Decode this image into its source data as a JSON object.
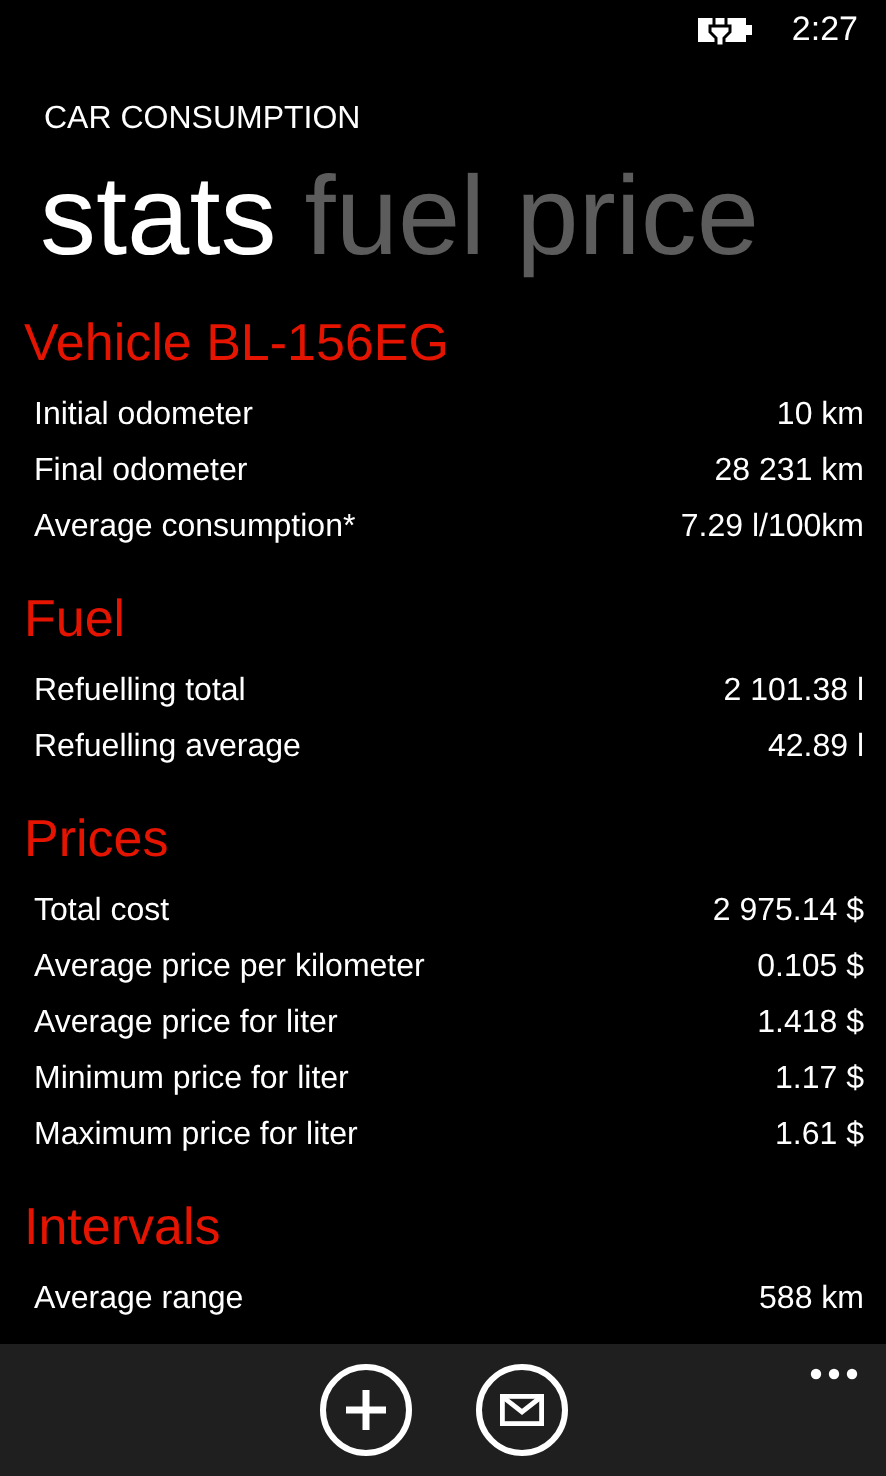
{
  "status_bar": {
    "time": "2:27",
    "charging": true
  },
  "app_title": "CAR CONSUMPTION",
  "pivot": [
    {
      "label": "stats",
      "selected": true
    },
    {
      "label": "fuel price",
      "selected": false
    }
  ],
  "sections": [
    {
      "title": "Vehicle BL-156EG",
      "rows": [
        {
          "label": "Initial odometer",
          "value": "10 km"
        },
        {
          "label": "Final odometer",
          "value": "28 231 km"
        },
        {
          "label": "Average consumption*",
          "value": "7.29 l/100km"
        }
      ]
    },
    {
      "title": "Fuel",
      "rows": [
        {
          "label": "Refuelling total",
          "value": "2 101.38 l"
        },
        {
          "label": "Refuelling average",
          "value": "42.89 l"
        }
      ]
    },
    {
      "title": "Prices",
      "rows": [
        {
          "label": "Total cost",
          "value": "2 975.14 $"
        },
        {
          "label": "Average price per kilometer",
          "value": "0.105 $"
        },
        {
          "label": "Average price for liter",
          "value": "1.418 $"
        },
        {
          "label": "Minimum price for liter",
          "value": "1.17 $"
        },
        {
          "label": "Maximum price for liter",
          "value": "1.61 $"
        }
      ]
    },
    {
      "title": "Intervals",
      "rows": [
        {
          "label": "Average range",
          "value": "588 km"
        }
      ]
    }
  ],
  "app_bar": {
    "buttons": [
      {
        "kind": "add"
      },
      {
        "kind": "mail"
      }
    ]
  }
}
